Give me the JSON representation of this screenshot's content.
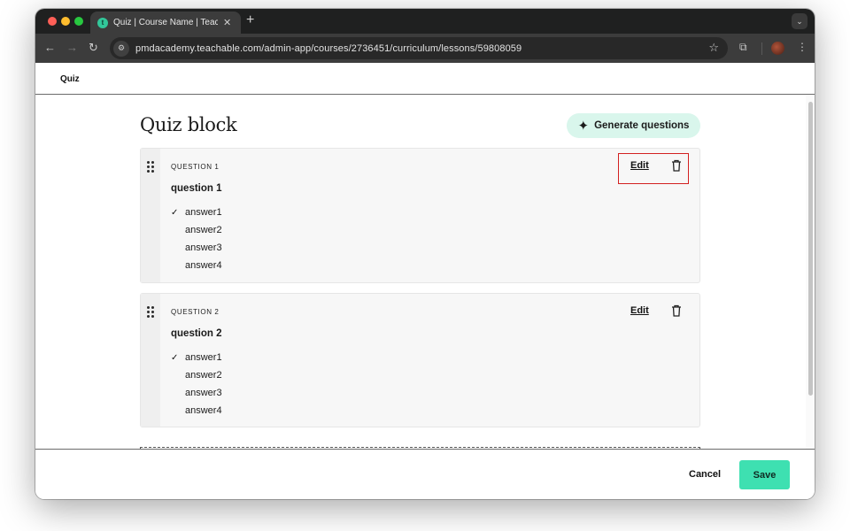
{
  "browser": {
    "tab_title": "Quiz | Course Name | Teachab",
    "tab_favicon": "t",
    "url": "pmdacademy.teachable.com/admin-app/courses/2736451/curriculum/lessons/59808059"
  },
  "header": {
    "title": "Quiz"
  },
  "main": {
    "heading": "Quiz block",
    "generate_label": "Generate questions",
    "questions": [
      {
        "label": "QUESTION 1",
        "text": "question 1",
        "edit_label": "Edit",
        "answers": [
          "answer1",
          "answer2",
          "answer3",
          "answer4"
        ],
        "correct_index": 0
      },
      {
        "label": "QUESTION 2",
        "text": "question 2",
        "edit_label": "Edit",
        "answers": [
          "answer1",
          "answer2",
          "answer3",
          "answer4"
        ],
        "correct_index": 0
      }
    ]
  },
  "footer": {
    "cancel_label": "Cancel",
    "save_label": "Save"
  },
  "colors": {
    "accent": "#3ee0b1",
    "generate_bg": "#d9f6ec",
    "highlight": "#d32020"
  },
  "icons": [
    "drag-handle-icon",
    "trash-icon",
    "sparkle-icon",
    "check-icon",
    "star-icon",
    "extensions-icon"
  ]
}
